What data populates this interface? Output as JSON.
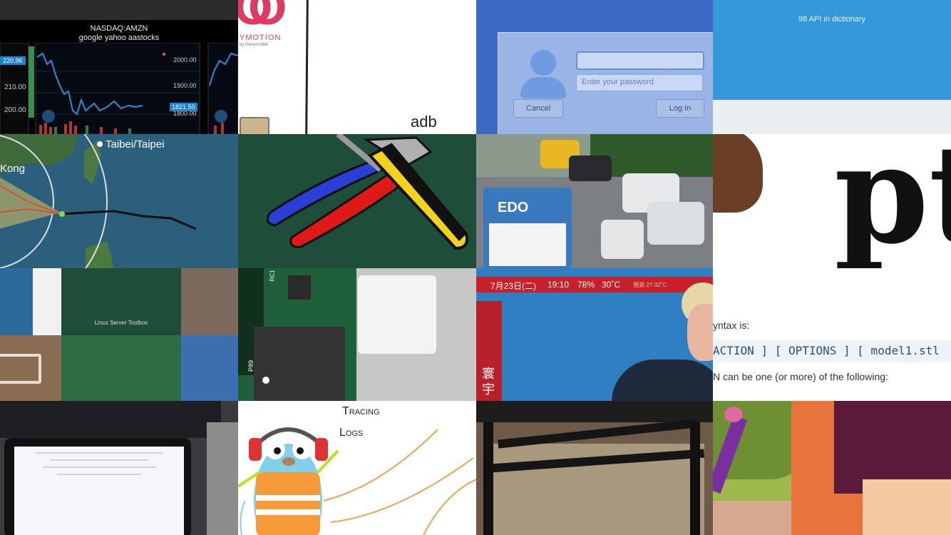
{
  "stock": {
    "ticker": "NASDAQ:AMZN",
    "source": "google yahoo aastocks",
    "left_price": "220.96",
    "left_ticks": [
      "210.00",
      "200.00"
    ],
    "right_ticks": [
      "2000.00",
      "1900.00",
      "1800.00"
    ],
    "right_price": "1821.50"
  },
  "genymotion": {
    "logo_letters": "O",
    "name": "YMOTION",
    "byline": "by Genymobile",
    "label": "adb"
  },
  "login": {
    "password_placeholder": "Enter your password",
    "cancel_label": "Cancel",
    "login_label": "Log In"
  },
  "api": {
    "title": "98 API in dictionary"
  },
  "typhoon": {
    "city1": "Taibei/Taipei",
    "city2": "Kong"
  },
  "traffic": {
    "bus_sign": "EDO"
  },
  "pt": {
    "text": "pt"
  },
  "collage": {
    "label": "Linux Server Toolbox"
  },
  "pcb": {
    "silk1": "P89",
    "silk2": "RC1"
  },
  "news": {
    "date": "7月23日(二)",
    "time": "19:10",
    "humidity": "78%",
    "temp": "30˚C",
    "forecast": "預測 27-32˚C",
    "chars": [
      "寰",
      "宇"
    ]
  },
  "manpage": {
    "syntax_label": "yntax is:",
    "syntax": "ACTION ] [ OPTIONS ] [ model1.stl",
    "following": "N can be one (or more) of the following:"
  },
  "gopher": {
    "line1": "Tracing",
    "line2": "Logs"
  },
  "colors": {
    "stock_bg": "#000000",
    "login_blue": "#4a7fd4",
    "api_blue": "#3498db",
    "pcb_green": "#1f5f3a",
    "tools_green": "#1e4d3a",
    "ocean": "#2c5f7c"
  }
}
